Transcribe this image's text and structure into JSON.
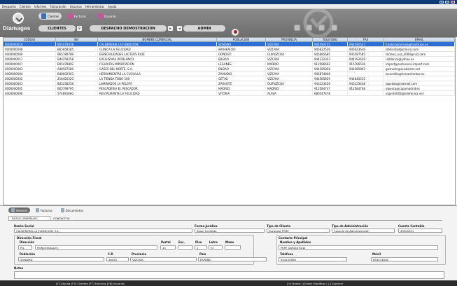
{
  "app": {
    "brand": "Diamages"
  },
  "menu": [
    "Despacho",
    "Clientes",
    "Informes",
    "Facturación",
    "Usuarios",
    "Herramientas",
    "Ayuda"
  ],
  "header": {
    "tabs": [
      {
        "label": "Clientes",
        "active": true,
        "icon": "clients-icon",
        "color": "#3b6fb6"
      },
      {
        "label": "Facturas",
        "active": false,
        "icon": "invoices-icon",
        "color": "#c9569a"
      },
      {
        "label": "Usuarios",
        "active": false,
        "icon": "users-icon",
        "color": "#c9569a"
      }
    ],
    "section_label": "CLIENTES",
    "office_label": "DESPACHO DEMOSTRACION",
    "user_label": "ADMIN",
    "icons": [
      "search-icon",
      "arrow-right-icon",
      "arrow-left-icon",
      "user-icon"
    ]
  },
  "grid": {
    "columns": [
      "CODIGO",
      "NIF",
      "NOMBRE COMERCIAL",
      "POBLACION",
      "PROVINCIA",
      "TELEFONO",
      "FAX",
      "EMAIL"
    ],
    "rows": [
      [
        "0000000010",
        "B05479478",
        "CALDERERIA LA FUNDICION",
        "SONDIKA",
        "VIZCAYA",
        "944592725",
        "944592527",
        "fundicionlarrona@fundicion.es"
      ],
      [
        "0000000008",
        "B65858585",
        "CLINICA LA FELICIDAD",
        "BARAKALDO",
        "VIZCAYA",
        "945622526",
        "945623636",
        "lafelicidad@clinica.com"
      ],
      [
        "0000000009",
        "B65789789",
        "ESPECIALIDADES LACTEOS RUIZ",
        "DONOSTI",
        "GUIPUZCOA",
        "945685685",
        "945587585",
        "lacteos_ruiz_2000@ruiz.com"
      ],
      [
        "0000000011",
        "B44259258",
        "EXCLUSIVAS RIOBLANCO",
        "BILBAO",
        "VIZCAYA",
        "944232323",
        "944192626",
        "rioblanco@yahoo.es"
      ],
      [
        "0000000007",
        "B05478892",
        "FIGURITAS IMPORTACION",
        "LEGANES",
        "MADRID",
        "912586692",
        "915786536",
        "import@exclusives-import.com"
      ],
      [
        "0000000003",
        "A48587589",
        "GASES DEL NORTE, S.A.",
        "BILBAO",
        "VIZCAYA",
        "944585858",
        "944585893",
        "gasnorte@euskalnet.net"
      ],
      [
        "0000000004",
        "B48002303",
        "HERRAMIENTAS LA CUCHILLA",
        "ZAMUDIO",
        "VIZCAYA",
        "945874848",
        "",
        "lacuchilla@herramientas.es"
      ],
      [
        "0000000002",
        "25845632G",
        "LA TIENDA TODO 100",
        "GETXO",
        "VIZCAYA",
        "944585859",
        "944845525",
        ""
      ],
      [
        "0000000001",
        "B05258258",
        "LAMINADOS LA PELOTA",
        "ZARAUTZ",
        "GUIPUZCOA",
        "943123456",
        "943123458",
        "lapelota@hotmail.com"
      ],
      [
        "0000000005",
        "B05799795",
        "PESCADERIA EL PESCADOR",
        "MADRID",
        "MADRID",
        "912584747",
        "912584748",
        "elpesca@capamadrid.es"
      ],
      [
        "0000000006",
        "57469586G",
        "RESTAURANTE LA FELICIDAD",
        "VITORIA",
        "ALAVA",
        "686547478",
        "",
        "vigente003@telefonica.net"
      ]
    ]
  },
  "detail": {
    "tabs": [
      {
        "label": "General",
        "active": true
      },
      {
        "label": "Facturas",
        "active": false
      },
      {
        "label": "Documentos",
        "active": false
      }
    ],
    "subtabs": [
      "DATOS GENERALES",
      "CONTACTOS"
    ],
    "labels": {
      "razon_social": "Razón Social",
      "forma_juridica": "Forma Jurídica",
      "tipo_cliente": "Tipo de Cliente",
      "tipo_admin": "Tipo de Administración",
      "cuenta_contable": "Cuenta Contable",
      "direccion_fiscal": "Dirección Fiscal",
      "direccion": "Dirección",
      "portal": "Portal",
      "esc": "Esc.",
      "piso": "Piso",
      "letra": "Letra",
      "mano": "Mano",
      "poblacion": "Población",
      "cp": "C.P.",
      "provincia": "Provincia",
      "pais": "País",
      "contacto_principal": "Contacto Principal",
      "nombre_apellidos": "Nombre y Apellidos",
      "telefono": "Teléfono",
      "movil": "Móvil",
      "notas": "Notas"
    },
    "values": {
      "razon_social": "CALDERERIA LA FUNDICION, S.L.",
      "forma_juridica": "Sdad. Limitada",
      "tipo_cliente": "Sociedad PYME",
      "tipo_admin": "Consejo de Administración",
      "cuenta_contable": "43000001",
      "via": "PQ.",
      "direccion": "RONCESVALLES",
      "portal": "15",
      "esc": "",
      "piso": "1",
      "letra": "F2",
      "mano": "",
      "poblacion": "SONDIKA",
      "cp": "48525",
      "provincia": "VIZCAYA",
      "pais": "ESPAÑA",
      "nombre_apellidos": "PEPE GARCIA RUIZ",
      "telefono": "944155858",
      "movil": "654474848",
      "notas": ""
    }
  },
  "status": {
    "left": "[F1] Ayuda [F3] Clientes [F7] Facturas [F8] Usuarios",
    "right": "[+] Nuevo | [Enter] Modificar | [-] Suprimir"
  }
}
